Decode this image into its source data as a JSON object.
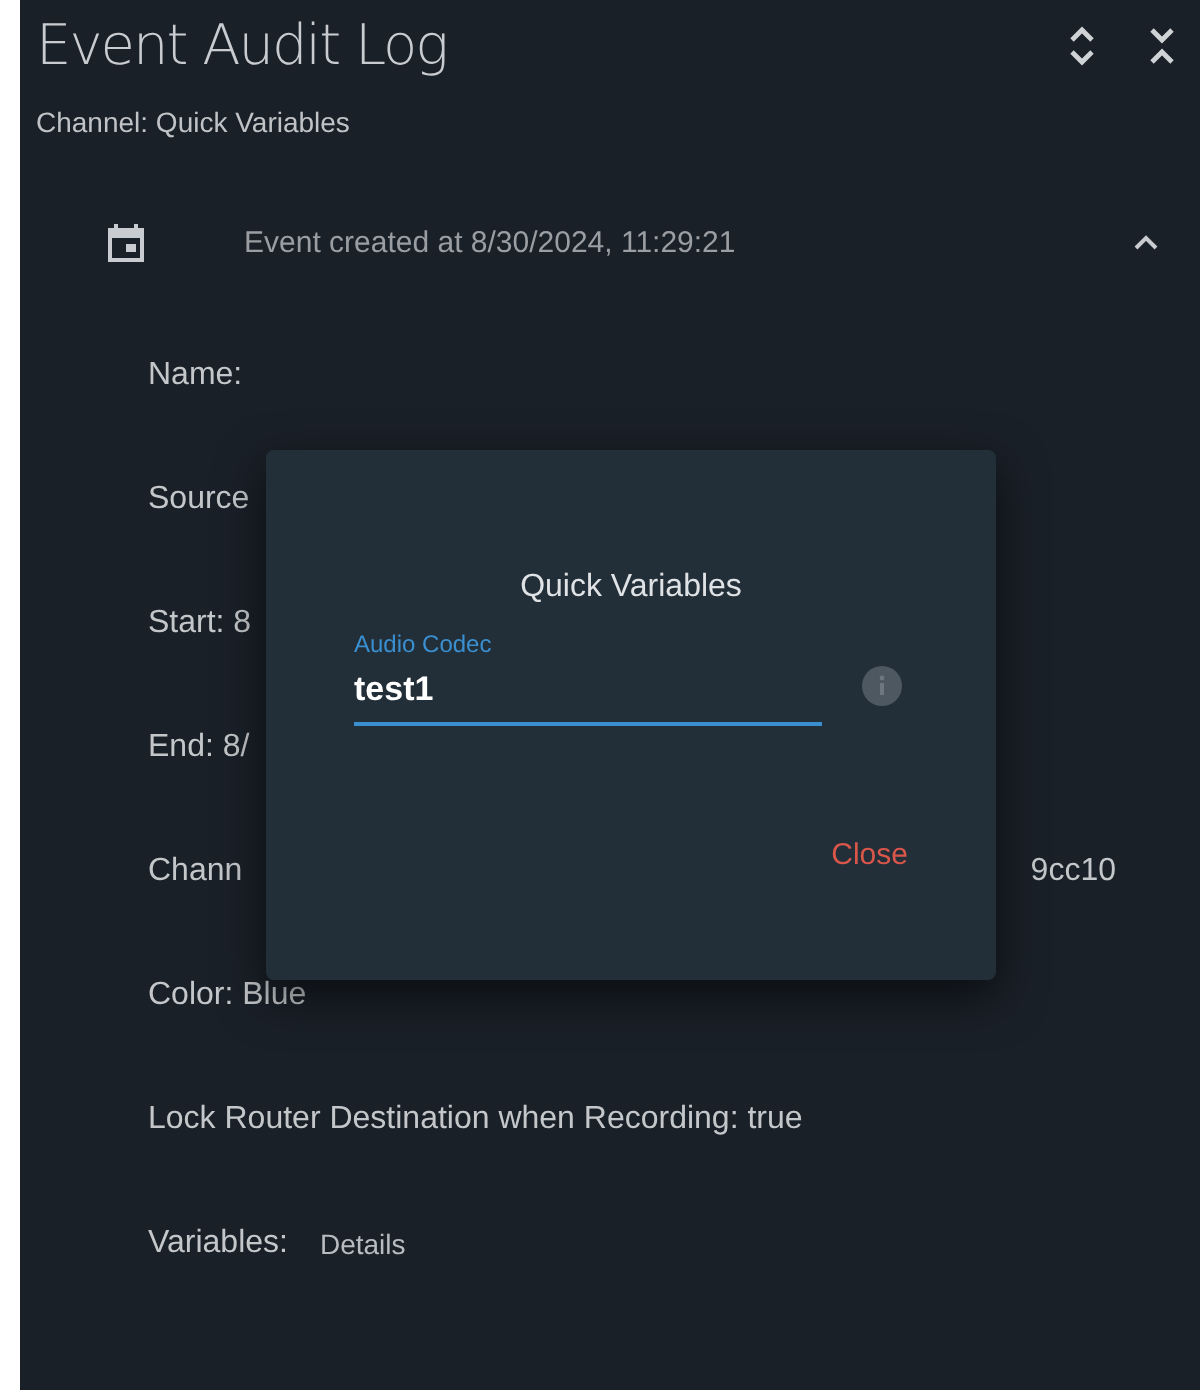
{
  "header": {
    "title": "Event Audit Log",
    "subtitle": "Channel: Quick Variables"
  },
  "event": {
    "title": "Event created at 8/30/2024, 11:29:21",
    "expanded": true,
    "rows": [
      {
        "kind": "text",
        "text": "Name:"
      },
      {
        "kind": "text",
        "text": "Source"
      },
      {
        "kind": "text",
        "text": "Start: 8"
      },
      {
        "kind": "text",
        "text": "End: 8/"
      },
      {
        "kind": "split",
        "text": "Chann",
        "tail": "9cc10"
      },
      {
        "kind": "text",
        "text": "Color: Blue"
      },
      {
        "kind": "text",
        "text": "Lock Router Destination when Recording: true"
      },
      {
        "kind": "action",
        "text": "Variables:",
        "button": "Details"
      }
    ]
  },
  "dialog": {
    "title": "Quick Variables",
    "field": {
      "label": "Audio Codec",
      "value": "test1",
      "focused": true
    },
    "button": "Close"
  }
}
